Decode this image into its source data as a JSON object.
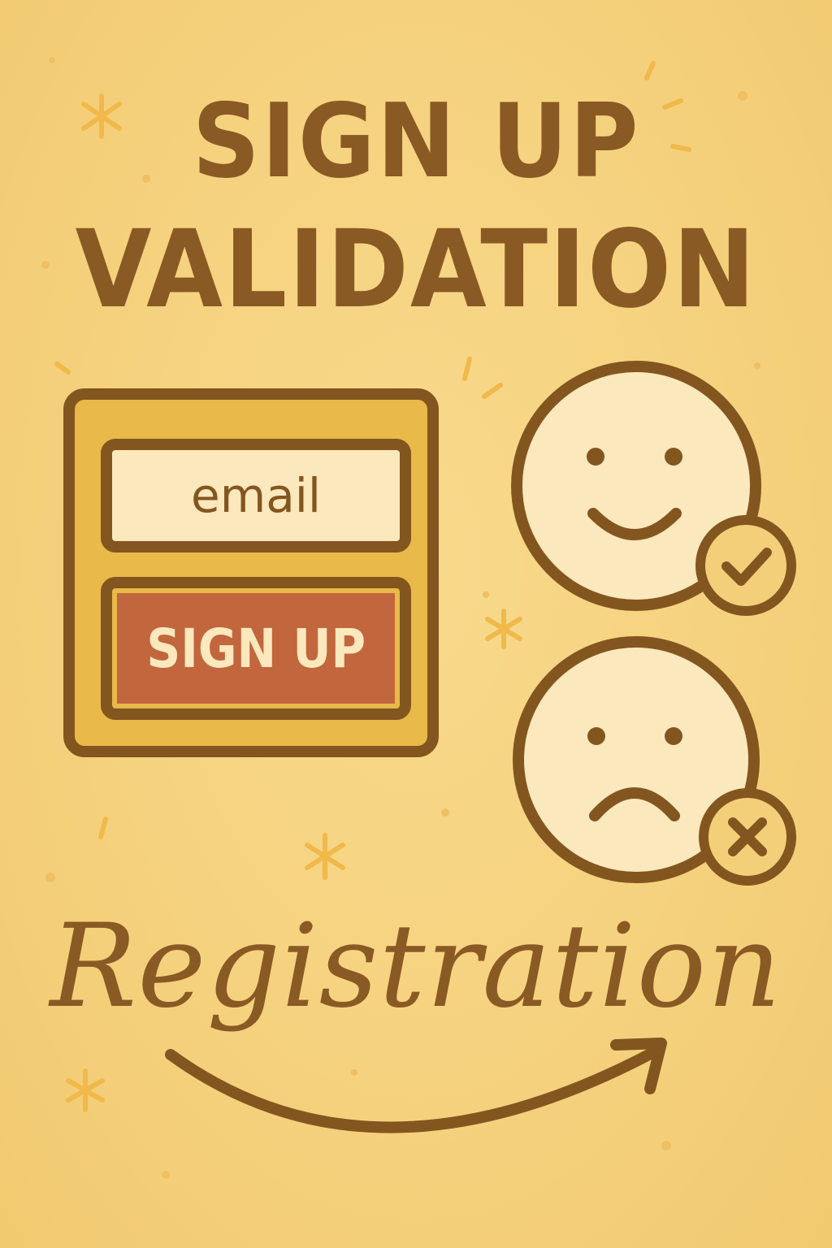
{
  "title": {
    "line1": "SIGN UP",
    "line2": "VALIDATION"
  },
  "form": {
    "email_placeholder": "email",
    "signup_label": "SIGN UP"
  },
  "faces": {
    "happy": "smiley-face-icon",
    "sad": "sad-face-icon"
  },
  "badges": {
    "valid": "check-icon",
    "invalid": "x-icon"
  },
  "footer": {
    "word": "Registration"
  },
  "colors": {
    "background": "#f5d27e",
    "ink": "#84561f",
    "card": "#e9b949",
    "field": "#fbe8bd",
    "button": "#c2663e",
    "sparkle": "#f0b94a"
  }
}
